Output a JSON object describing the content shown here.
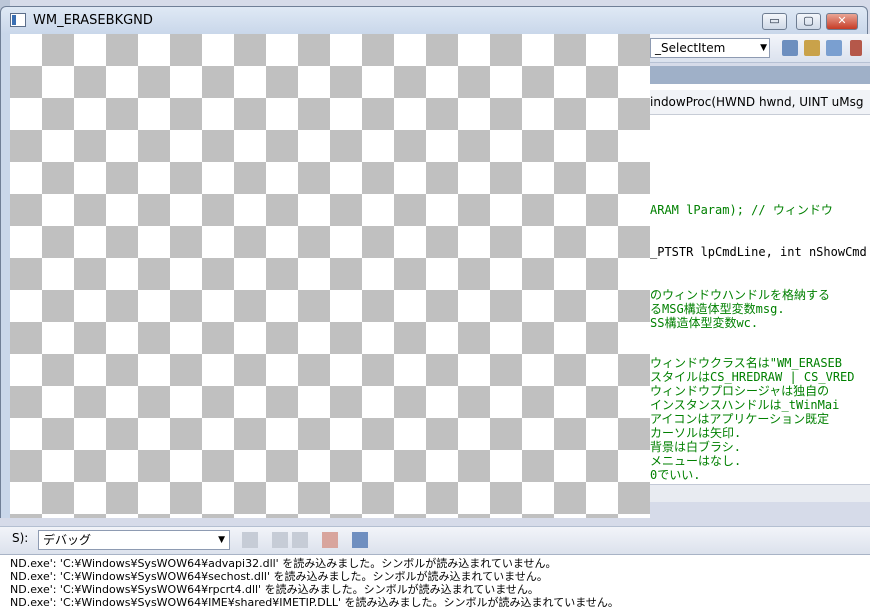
{
  "window": {
    "title": "WM_ERASEBKGND",
    "minimize_label": "▭",
    "maximize_label": "▢",
    "close_label": "✕"
  },
  "ide": {
    "member_combo": "_SelectItem",
    "function_signature": "indowProc(HWND hwnd, UINT uMsg",
    "code_lines": [
      {
        "text": "ARAM lParam);    // ウィンドウ",
        "type": "mixed"
      },
      {
        "text": "_PTSTR lpCmdLine, int nShowCmd",
        "type": "code"
      }
    ],
    "comment_block_1": [
      "のウィンドウハンドルを格納する",
      "るMSG構造体型変数msg.",
      "SS構造体型変数wc."
    ],
    "comment_block_2": [
      "ウィンドウクラス名は\"WM_ERASEB",
      "スタイルはCS_HREDRAW | CS_VRED",
      "ウィンドウプロシージャは独自の",
      "インスタンスハンドルは_tWinMai",
      "アイコンはアプリケーション既定",
      "カーソルは矢印.",
      "背景は白ブラシ.",
      "メニューはなし.",
      "0でいい."
    ],
    "output": {
      "source_label": "S):",
      "source_value": "デバッグ",
      "lines": [
        "ND.exe': 'C:¥Windows¥SysWOW64¥advapi32.dll' を読み込みました。シンボルが読み込まれていません。",
        "ND.exe': 'C:¥Windows¥SysWOW64¥sechost.dll' を読み込みました。シンボルが読み込まれていません。",
        "ND.exe': 'C:¥Windows¥SysWOW64¥rpcrt4.dll' を読み込みました。シンボルが読み込まれていません。",
        "ND.exe': 'C:¥Windows¥SysWOW64¥IME¥shared¥IMETIP.DLL' を読み込みました。シンボルが読み込まれていません。"
      ]
    }
  },
  "colors": {
    "checker_dark": "#c0c0c0",
    "checker_light": "#ffffff",
    "comment": "#008000",
    "keyword": "#0000ff"
  }
}
